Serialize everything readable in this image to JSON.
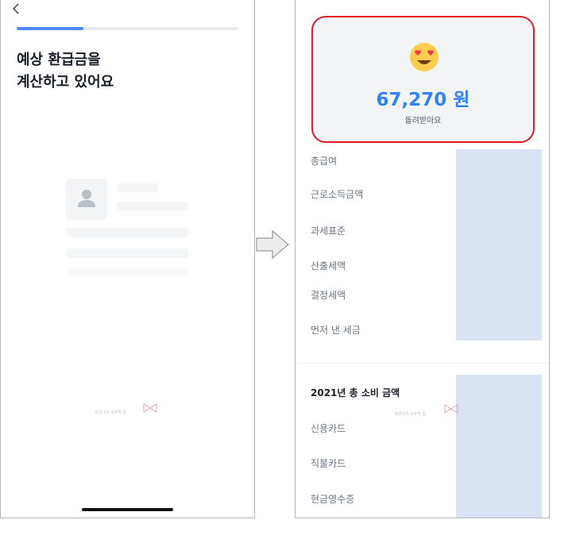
{
  "left_screen": {
    "back_icon": "chevron-left-icon",
    "progress": 0.3,
    "title_line1": "예상 환급금을",
    "title_line2": "계산하고 있어요",
    "watermark": "코코나의 오두막 집"
  },
  "right_screen": {
    "emoji": "heart-eyes-emoji-icon",
    "refund_amount": "67,270 원",
    "refund_caption": "돌려받아요",
    "rows": [
      "총급여",
      "근로소득금액",
      "과세표준",
      "산출세액",
      "결정세액",
      "먼저 낸 세금"
    ],
    "consumption_title": "2021년 총 소비 금액",
    "consumption_rows": [
      "신용카드",
      "직불카드",
      "현금영수증"
    ],
    "watermark": "코코나의 오두막 집"
  },
  "colors": {
    "accent": "#3182f6",
    "highlight_border": "#e31b23",
    "redaction": "#d9e3f3"
  }
}
